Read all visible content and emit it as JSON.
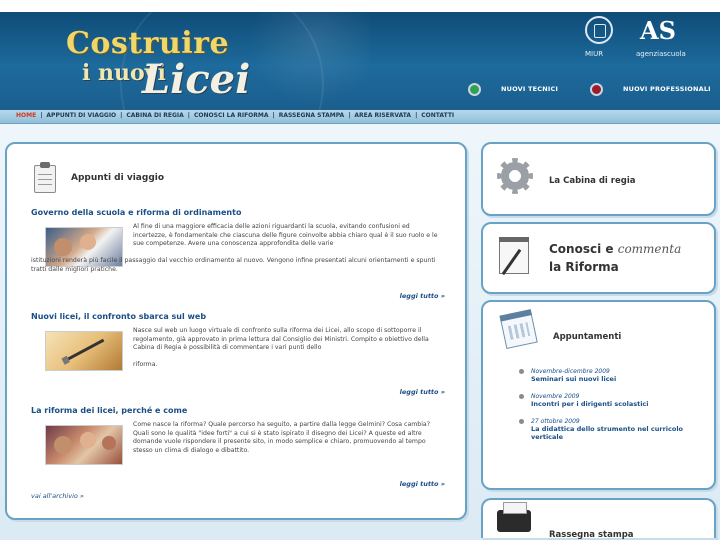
{
  "header": {
    "logo_line1": "Costruire",
    "logo_line2": "i nuovi",
    "logo_line3": "Licei",
    "miur_label": "MIUR",
    "as_logo": "AS",
    "as_label": "agenziascuola",
    "nav_tecnici": "NUOVI TECNICI",
    "nav_professionali": "NUOVI PROFESSIONALI",
    "colors": {
      "header_blue": "#1d6a9c",
      "logo_gold": "#f0d76a",
      "tecnici_dot": "#2fa24f",
      "professionali_dot": "#9b1c2a"
    }
  },
  "menu": {
    "items": [
      "HOME",
      "APPUNTI DI VIAGGIO",
      "CABINA DI REGIA",
      "CONOSCI LA RIFORMA",
      "RASSEGNA STAMPA",
      "AREA RISERVATA",
      "CONTATTI"
    ]
  },
  "main": {
    "title": "Appunti di viaggio",
    "icon": "clipboard-icon",
    "articles": [
      {
        "title": "Governo della scuola e riforma di ordinamento",
        "text_right": "Al fine di una maggiore efficacia delle azioni riguardanti la scuola, evitando confusioni ed incertezze, è fondamentale che ciascuna delle figure coinvolte abbia chiaro qual è il suo ruolo e le sue competenze. Avere una conoscenza approfondita delle varie",
        "text_wide": "istituzioni renderà più facile il passaggio dal vecchio ordinamento al nuovo. Vengono infine presentati alcuni orientamenti e spunti tratti dalle migliori pratiche.",
        "leggi": "leggi tutto »"
      },
      {
        "title": "Nuovi licei, il confronto sbarca sul web",
        "text_right": "Nasce sul web un luogo virtuale di confronto sulla riforma dei Licei, allo scopo di sottoporre il regolamento, già approvato in prima lettura dal Consiglio dei Ministri. Compito e obiettivo della Cabina di Regia è possibilità di commentare i vari punti dello",
        "text_wide": "riforma.",
        "leggi": "leggi tutto »"
      },
      {
        "title": "La riforma dei licei, perché e come",
        "text_right": "Come nasce la riforma? Quale percorso ha seguito, a partire dalla legge Gelmini? Cosa cambia? Quali sono le qualità \"idee forti\" a cui si è stato ispirato il disegno dei Licei? A queste ed altre domande vuole rispondere il presente sito, in modo semplice e chiaro, promuovendo al tempo stesso un clima di dialogo e dibattito.",
        "text_wide": "",
        "leggi": "leggi tutto »"
      }
    ],
    "archivio": "vai all'archivio »"
  },
  "side": {
    "cabina_title": "La Cabina di regia",
    "conosci_title_1": "Conosci e",
    "conosci_title_2": "commenta",
    "conosci_title_3": "la Riforma",
    "appuntamenti_title": "Appuntamenti",
    "appuntamenti": [
      {
        "date": "Novembre-dicembre 2009",
        "title": "Seminari sui nuovi licei"
      },
      {
        "date": "Novembre 2009",
        "title": "Incontri per i dirigenti scolastici"
      },
      {
        "date": "27 ottobre 2009",
        "title": "La didattica dello strumento nel curricolo verticale"
      }
    ],
    "rassegna_title": "Rassegna stampa"
  }
}
